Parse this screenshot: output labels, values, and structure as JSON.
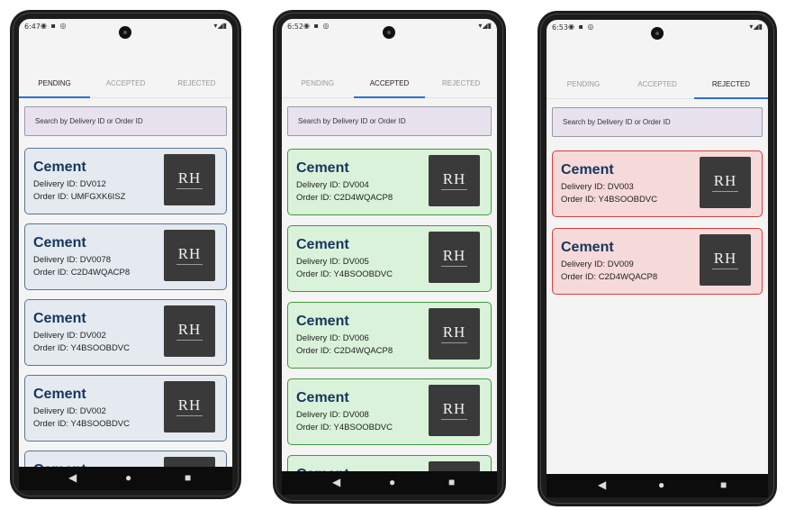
{
  "brand_colors": {
    "tab_indicator": "#2f6fd6",
    "pending": "#5b7591",
    "accepted": "#3f9a3f",
    "rejected": "#d93b3b"
  },
  "tabs": [
    "PENDING",
    "ACCEPTED",
    "REJECTED"
  ],
  "search_placeholder": "Search by Delivery ID or Order ID",
  "logo_text": "RH",
  "nav_icons": {
    "back": "◀",
    "home": "●",
    "recents": "■"
  },
  "screens": [
    {
      "status_time": "6:47",
      "status_icons": "◉ ▪ ◎",
      "status_right": "▾◢▮",
      "active_tab": "PENDING",
      "cards": [
        {
          "title": "Cement",
          "delivery": "Delivery ID: DV012",
          "order": "Order ID: UMFGXK6ISZ"
        },
        {
          "title": "Cement",
          "delivery": "Delivery ID: DV0078",
          "order": "Order ID: C2D4WQACP8"
        },
        {
          "title": "Cement",
          "delivery": "Delivery ID: DV002",
          "order": "Order ID: Y4BSOOBDVC"
        },
        {
          "title": "Cement",
          "delivery": "Delivery ID: DV002",
          "order": "Order ID: Y4BSOOBDVC"
        },
        {
          "title": "Cement",
          "delivery": "",
          "order": ""
        }
      ]
    },
    {
      "status_time": "6:52",
      "status_icons": "◉ ▪ ◎",
      "status_right": "▾◢▮",
      "active_tab": "ACCEPTED",
      "cards": [
        {
          "title": "Cement",
          "delivery": "Delivery ID: DV004",
          "order": "Order ID: C2D4WQACP8"
        },
        {
          "title": "Cement",
          "delivery": "Delivery ID: DV005",
          "order": "Order ID: Y4BSOOBDVC"
        },
        {
          "title": "Cement",
          "delivery": "Delivery ID: DV006",
          "order": "Order ID: C2D4WQACP8"
        },
        {
          "title": "Cement",
          "delivery": "Delivery ID: DV008",
          "order": "Order ID: Y4BSOOBDVC"
        },
        {
          "title": "Cement",
          "delivery": "",
          "order": ""
        }
      ]
    },
    {
      "status_time": "6:53",
      "status_icons": "◉ ▪ ◎",
      "status_right": "▾◢▮",
      "active_tab": "REJECTED",
      "cards": [
        {
          "title": "Cement",
          "delivery": "Delivery ID: DV003",
          "order": "Order ID: Y4BSOOBDVC"
        },
        {
          "title": "Cement",
          "delivery": "Delivery ID: DV009",
          "order": "Order ID: C2D4WQACP8"
        }
      ]
    }
  ]
}
